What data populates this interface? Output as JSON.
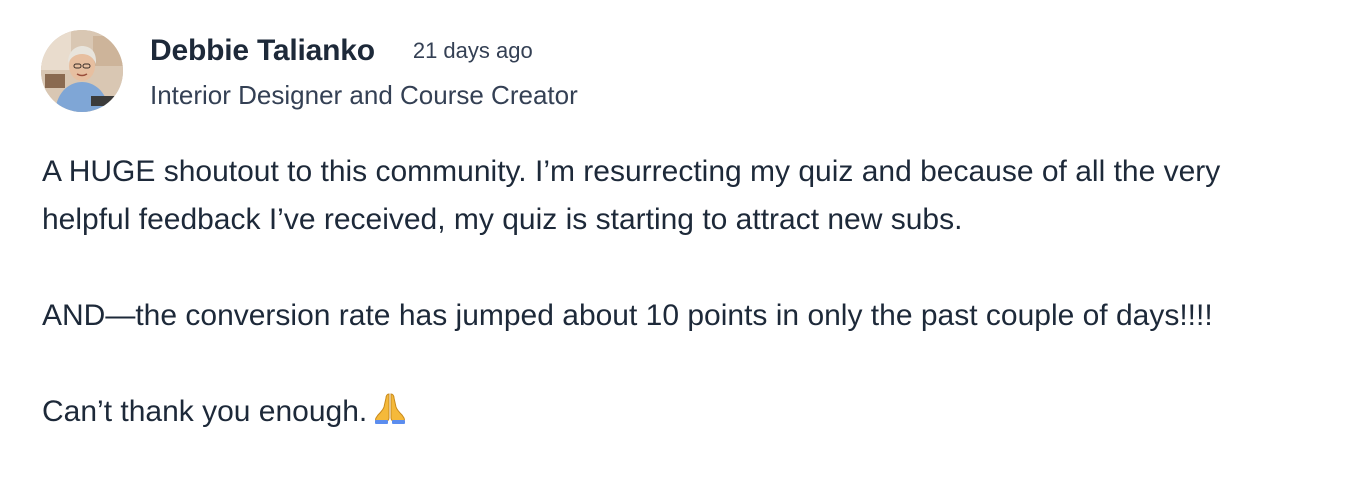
{
  "post": {
    "author": {
      "name": "Debbie Talianko",
      "title": "Interior Designer and Course Creator",
      "avatar_icon": "avatar-photo"
    },
    "timestamp": "21 days ago",
    "paragraphs": [
      "A HUGE shoutout to this community. I’m resurrecting my quiz and because of all the very helpful feedback I’ve received, my quiz is starting to attract new subs.",
      "AND—the conversion rate has jumped about 10 points in only the past couple of days!!!!",
      "Can’t thank you enough."
    ],
    "closing_emoji": "folded-hands-icon"
  },
  "colors": {
    "text_primary": "#1d2939",
    "text_secondary": "#344054",
    "background": "#ffffff",
    "emoji_hands": "#f5b93a"
  }
}
